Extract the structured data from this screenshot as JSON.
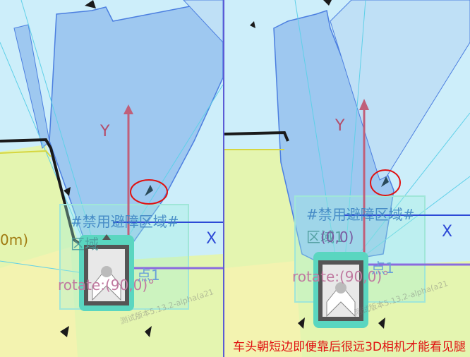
{
  "left_view": {
    "axis_y_label": "Y",
    "axis_x_label": "X",
    "zone_label_line1": "#禁用避障区域#",
    "zone_label_line2": "区域",
    "rotate_label": "rotate:(90,0)°",
    "point_label": "点1",
    "meters_label": "0m)",
    "watermark": "测试版本5.13.2-alpha(a21"
  },
  "right_view": {
    "axis_y_label": "Y",
    "axis_x_label": "X",
    "zone_label_line1": "#禁用避障区域#",
    "zone_label_line2": "区域1",
    "coords_label": "(0,0)",
    "rotate_label": "rotate:(90,0)°",
    "point_label": "点1",
    "watermark": "测试版本5.13.2-alpha(a21"
  },
  "caption": "车头朝短边即便靠后很远3D相机才能看见腿",
  "colors": {
    "sky_blue": "#cdeefa",
    "fan_blue": "#9ec8f0",
    "ground_green": "#e4f5b0",
    "highlight_circle": "#e01010",
    "axis_y": "#b34d6b",
    "axis_x": "#2d49d6",
    "robot_body": "#5ad6c0"
  }
}
